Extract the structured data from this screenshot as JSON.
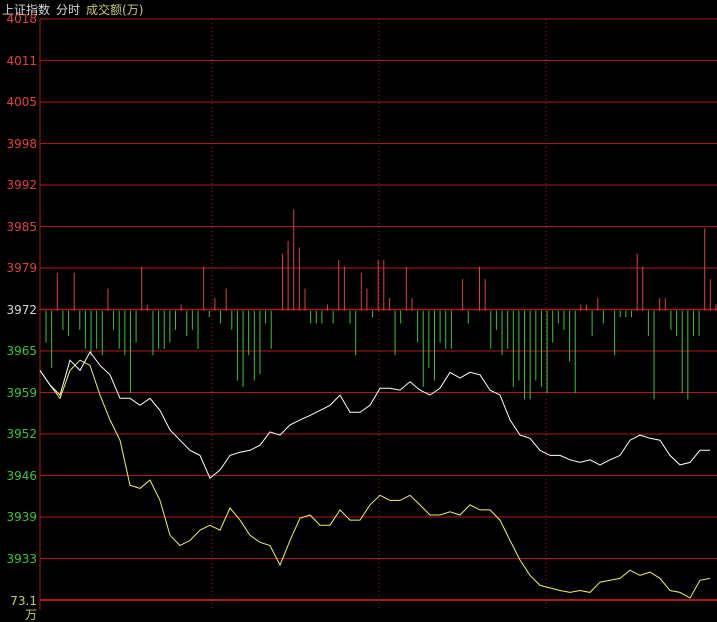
{
  "header": {
    "index_name": "上证指数",
    "mode": "分时",
    "indicator": "成交额(万)"
  },
  "colors": {
    "up": "#e04040",
    "down": "#40c040",
    "grid": "#b01818",
    "price_line": "#ffffff",
    "avg_line": "#f0f060",
    "base_label": "#d8d8d8",
    "vol_label": "#c8c878"
  },
  "chart_data": {
    "type": "line",
    "title": "上证指数 分时",
    "ylim": [
      3926.4,
      4018
    ],
    "base": 3972,
    "y_ticks": [
      4018,
      4011,
      4005,
      3998,
      3992,
      3985,
      3979,
      3972,
      3965,
      3959,
      3952,
      3946,
      3939,
      3933
    ],
    "bottom_label": "73.1万",
    "x_range_minutes": [
      0,
      240
    ],
    "series": [
      {
        "name": "price",
        "values": [
          3962.6,
          3960.3,
          3958.7,
          3964.2,
          3962.6,
          3965.5,
          3963.4,
          3961.9,
          3958.2,
          3958.2,
          3957.1,
          3958.2,
          3956.3,
          3953.2,
          3951.6,
          3950.0,
          3949.2,
          3945.6,
          3946.9,
          3949.2,
          3949.7,
          3950.0,
          3950.8,
          3952.9,
          3952.4,
          3954.0,
          3954.8,
          3955.5,
          3956.3,
          3957.1,
          3958.7,
          3956.0,
          3956.0,
          3957.1,
          3959.8,
          3959.8,
          3959.5,
          3960.8,
          3959.5,
          3958.7,
          3959.8,
          3962.3,
          3961.4,
          3962.3,
          3961.9,
          3959.5,
          3958.7,
          3954.8,
          3952.4,
          3951.9,
          3950.0,
          3949.2,
          3949.2,
          3948.5,
          3948.1,
          3948.5,
          3947.7,
          3948.5,
          3949.2,
          3951.6,
          3952.4,
          3951.9,
          3951.6,
          3949.2,
          3947.7,
          3948.1,
          3950.0,
          3950.0
        ]
      },
      {
        "name": "average",
        "values": [
          3962.6,
          3960.3,
          3958.2,
          3962.6,
          3964.2,
          3963.4,
          3958.7,
          3954.8,
          3951.6,
          3944.5,
          3944.0,
          3945.3,
          3942.1,
          3936.6,
          3935.0,
          3935.8,
          3937.4,
          3938.2,
          3937.4,
          3940.9,
          3939.0,
          3936.6,
          3935.5,
          3935.0,
          3931.9,
          3935.8,
          3939.3,
          3939.8,
          3938.2,
          3938.2,
          3940.6,
          3939.0,
          3939.0,
          3941.4,
          3942.9,
          3942.1,
          3942.1,
          3942.9,
          3941.4,
          3939.8,
          3939.8,
          3940.3,
          3939.8,
          3941.4,
          3940.6,
          3940.6,
          3939.0,
          3935.8,
          3932.7,
          3930.3,
          3928.7,
          3928.3,
          3927.9,
          3927.6,
          3927.9,
          3927.6,
          3929.2,
          3929.5,
          3929.8,
          3931.1,
          3930.3,
          3930.8,
          3929.8,
          3927.9,
          3927.6,
          3926.7,
          3929.5,
          3929.8
        ]
      },
      {
        "name": "breadth_bars",
        "values": [
          -5,
          -9,
          6,
          -3,
          -4,
          6,
          -3,
          -6,
          -7,
          -6,
          -7,
          3.5,
          -3,
          -6,
          -7,
          -13,
          -5,
          7,
          1,
          -7,
          -6,
          -6,
          -5,
          -3,
          1,
          -4,
          -3,
          -6,
          7,
          -1,
          2,
          -2,
          3.5,
          -3,
          -11,
          -12,
          -7,
          -11,
          -10,
          -2,
          -6,
          0,
          9,
          11,
          16,
          10,
          3.5,
          -2,
          -2,
          -2,
          1,
          -2,
          8,
          7,
          -2,
          -7,
          6,
          3.5,
          -1,
          8,
          8,
          2,
          -7,
          -2,
          7,
          2,
          -5,
          -12,
          -9,
          -11,
          -5,
          -6,
          -6,
          0,
          5,
          -2,
          0,
          7,
          5,
          -6,
          -3,
          -7,
          -6,
          -12,
          -11,
          -14,
          -14,
          -11,
          -12,
          -13,
          -5,
          -2,
          -3,
          -8,
          -13,
          1,
          1,
          -4,
          2,
          -2,
          0,
          -7,
          -1,
          -1,
          -1,
          9,
          7,
          -4,
          -14,
          2,
          2,
          -3,
          -4,
          -13,
          -14,
          -4,
          -4,
          13,
          5,
          1
        ]
      }
    ]
  }
}
